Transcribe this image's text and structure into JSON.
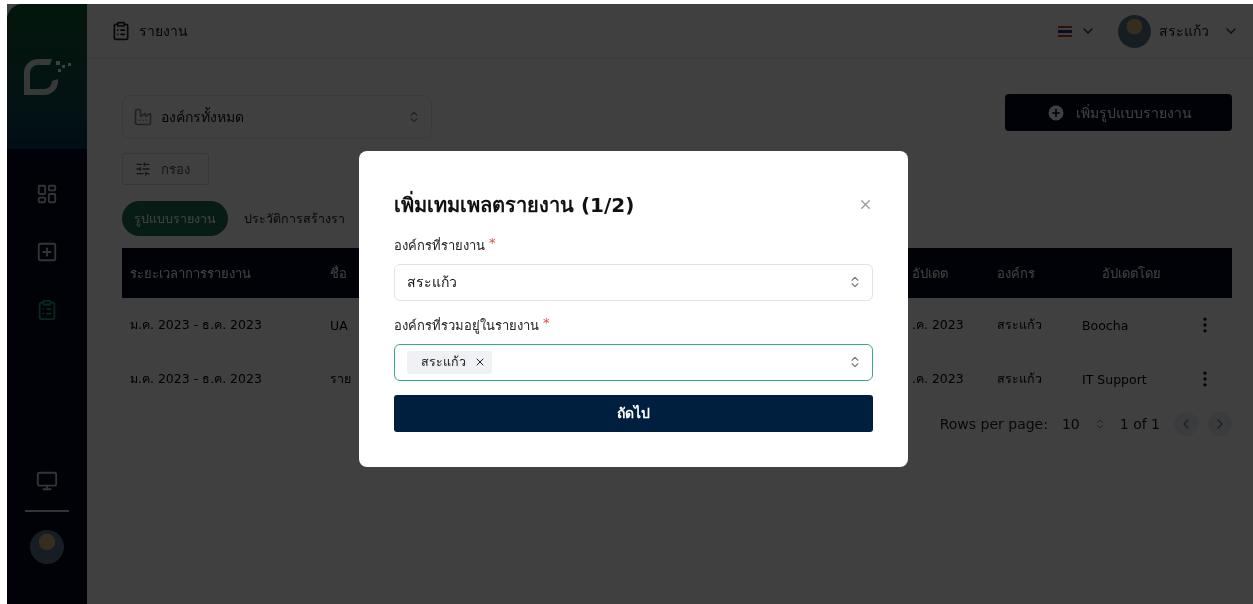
{
  "sidebar": {
    "nav_items": [
      {
        "kind": "dashboard",
        "selected": false
      },
      {
        "kind": "add",
        "selected": false
      },
      {
        "kind": "report",
        "selected": true
      }
    ],
    "bottom_items": [
      {
        "kind": "monitor"
      }
    ]
  },
  "header": {
    "title": "รายงาน",
    "user_name": "สระแก้ว"
  },
  "org_select": {
    "value": "องค์กรทั้งหมด"
  },
  "filter_button": "กรอง",
  "add_button": "เพิ่มรูปแบบรายงาน",
  "tabs": [
    {
      "label": "รูปแบบรายงาน",
      "selected": true
    },
    {
      "label": "ประวัติการสร้างรา",
      "selected": false
    }
  ],
  "table": {
    "columns": [
      "ระยะเวลาการรายงาน",
      "ชื่อ",
      "อัปเดต",
      "องค์กร",
      "อัปเดตโดย"
    ],
    "rows": [
      [
        "ม.ค. 2023 - ธ.ค. 2023",
        "UA",
        ".ค. 2023",
        "สระแก้ว",
        "Boocha"
      ],
      [
        "ม.ค. 2023 - ธ.ค. 2023",
        "ราย",
        ".ค. 2023",
        "สระแก้ว",
        "IT Support"
      ]
    ]
  },
  "pagination": {
    "label": "Rows per page:",
    "rows_per_page": "10",
    "range": "1 of 1"
  },
  "modal": {
    "title": "เพิ่มเทมเพลตรายงาน (1/2)",
    "fields": [
      {
        "kind": "select",
        "label": "องค์กรที่รายงาน",
        "required_mark": "*",
        "value": "สระแก้ว",
        "focused": false
      },
      {
        "kind": "multi",
        "label": "องค์กรที่รวมอยู่ในรายงาน",
        "required_mark": "*",
        "tags": [
          "สระแก้ว"
        ],
        "focused": true
      }
    ],
    "submit": "ถัดไป"
  }
}
